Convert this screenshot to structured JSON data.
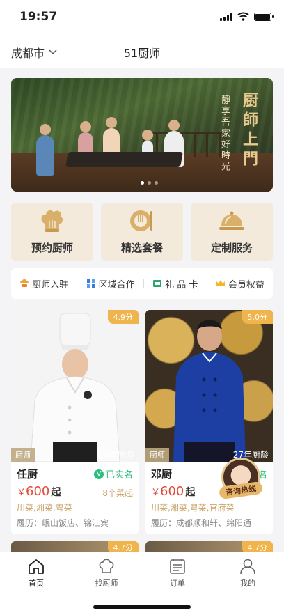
{
  "status_bar": {
    "time": "19:57"
  },
  "header": {
    "city": "成都市",
    "title": "51厨师"
  },
  "banner": {
    "headline": "厨師上門",
    "tagline": "靜享吾家好時光",
    "active_slide": 1,
    "slide_count": 3
  },
  "features": [
    {
      "label": "预约厨师",
      "icon": "chef-hat-icon"
    },
    {
      "label": "精选套餐",
      "icon": "plate-cutlery-icon"
    },
    {
      "label": "定制服务",
      "icon": "cloche-icon"
    }
  ],
  "quick_links": [
    {
      "label": "厨师入驻",
      "icon": "chef-icon"
    },
    {
      "label": "区域合作",
      "icon": "cooperation-icon"
    },
    {
      "label": "礼 品 卡",
      "icon": "gift-card-icon"
    },
    {
      "label": "会员权益",
      "icon": "crown-icon"
    }
  ],
  "chefs": [
    {
      "name": "任厨",
      "rating": "4.9分",
      "tag": "厨师",
      "years": "26年厨龄",
      "verified": "已实名",
      "currency": "￥",
      "price": "600",
      "price_suffix": "起",
      "dishes": "8个菜起",
      "cuisine": "川菜,湘菜,粤菜",
      "history": "履历：岷山饭店、锦江宾"
    },
    {
      "name": "邓厨",
      "rating": "5.0分",
      "tag": "厨师",
      "years": "27年厨龄",
      "verified": "名",
      "currency": "￥",
      "price": "600",
      "price_suffix": "起",
      "cuisine": "川菜,湘菜,粤菜,官府菜",
      "history": "履历：成都顺和轩、绵阳通"
    }
  ],
  "next_cards": [
    {
      "rating": "4.7分"
    },
    {
      "rating": "4.7分"
    }
  ],
  "hotline": {
    "label": "咨询热线"
  },
  "tabbar": [
    {
      "label": "首页",
      "icon": "home-icon",
      "active": true
    },
    {
      "label": "找厨师",
      "icon": "chef-hat-icon",
      "active": false
    },
    {
      "label": "订单",
      "icon": "order-list-icon",
      "active": false
    },
    {
      "label": "我的",
      "icon": "user-icon",
      "active": false
    }
  ],
  "colors": {
    "accent_gold": "#c9a46a",
    "price_red": "#e24a3a",
    "verified_green": "#2dbd7e",
    "rating_orange": "#f0b44c",
    "feature_bg": "#f3eadb"
  }
}
